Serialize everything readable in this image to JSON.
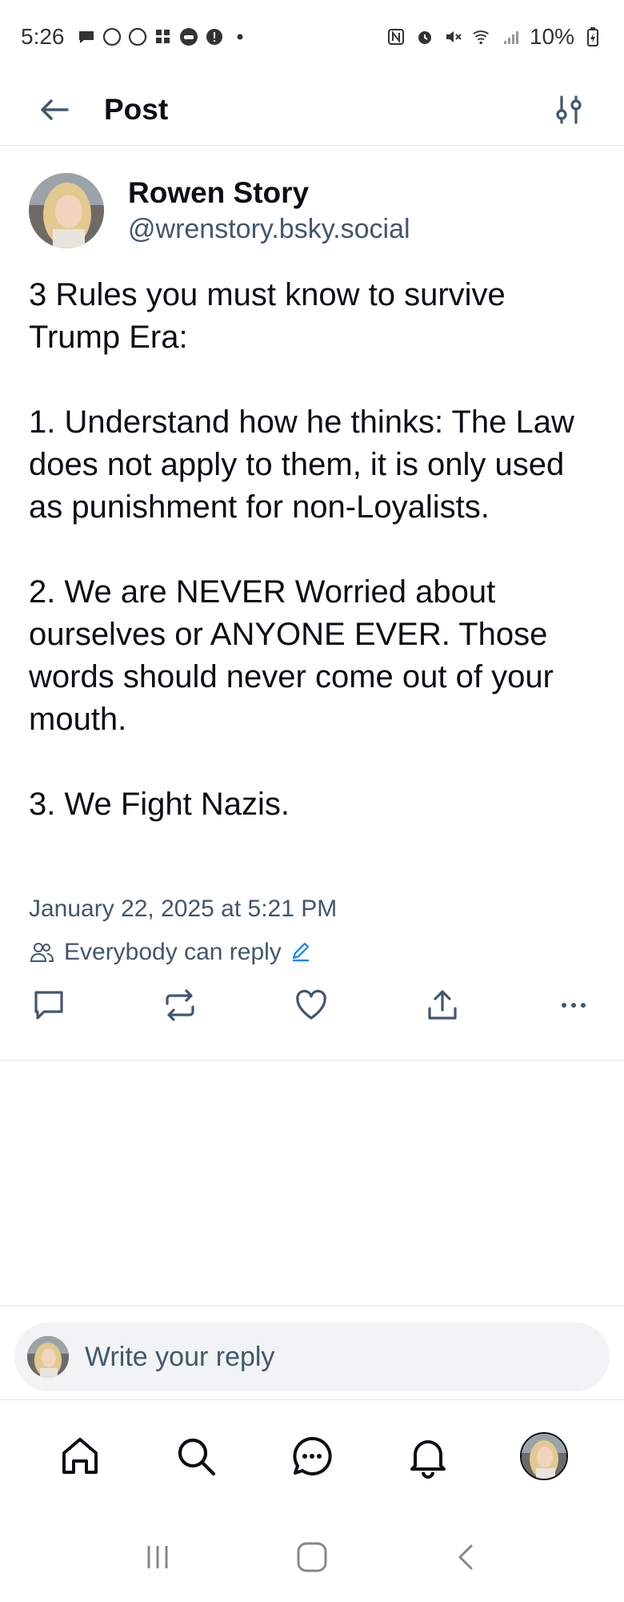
{
  "status_bar": {
    "time": "5:26",
    "battery": "10%",
    "left_icons": [
      "chat-bubble-icon",
      "circle-icon",
      "circle-icon",
      "apps-icon",
      "game-icon",
      "alert-icon",
      "dot-icon"
    ],
    "right_icons": [
      "nfc-icon",
      "alarm-icon",
      "mute-icon",
      "wifi-6e-icon",
      "signal-icon",
      "battery-icon"
    ]
  },
  "header": {
    "title": "Post",
    "back_icon": "arrow-left-icon",
    "settings_icon": "sliders-icon"
  },
  "post": {
    "author": {
      "name": "Rowen Story",
      "handle": "@wrenstory.bsky.social"
    },
    "body": {
      "intro": "3 Rules you must know to survive Trump Era:",
      "rule1": "1. Understand how he thinks: The Law does not apply to them, it is only used as punishment for non-Loyalists.",
      "rule2": "2. We are NEVER Worried about ourselves or ANYONE EVER. Those words should never come out of your mouth.",
      "rule3": "3. We Fight Nazis."
    },
    "timestamp": "January 22, 2025 at 5:21 PM",
    "reply_permission": "Everybody can reply",
    "actions": [
      "reply-icon",
      "repost-icon",
      "like-icon",
      "share-icon",
      "more-icon"
    ]
  },
  "composer": {
    "placeholder": "Write your reply"
  },
  "bottom_nav": [
    "home-icon",
    "search-icon",
    "messages-icon",
    "notifications-icon",
    "profile-avatar"
  ],
  "system_nav": [
    "recents-icon",
    "home-square-icon",
    "back-chevron-icon"
  ],
  "colors": {
    "text_primary": "#0b0f14",
    "text_secondary": "#42576c",
    "accent": "#1083fe",
    "divider": "#e6e9ed",
    "composer_bg": "#f1f3f5"
  }
}
